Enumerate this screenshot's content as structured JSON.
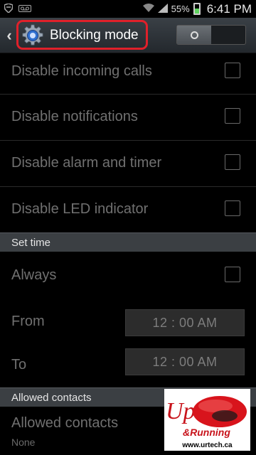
{
  "status_bar": {
    "battery_percent": "55%",
    "time": "6:41 PM",
    "icons": [
      "shield-icon",
      "voicemail-icon",
      "wifi-icon",
      "signal-icon",
      "battery-icon"
    ]
  },
  "action_bar": {
    "title": "Blocking mode",
    "toggle_on": false,
    "highlight_color": "#e0202a"
  },
  "items": {
    "incoming_calls": "Disable incoming calls",
    "notifications": "Disable notifications",
    "alarm_timer": "Disable alarm and timer",
    "led_indicator": "Disable LED indicator"
  },
  "set_time": {
    "header": "Set time",
    "always": "Always",
    "from_label": "From",
    "from_value": "12 : 00 AM",
    "to_label": "To",
    "to_value": "12 : 00 AM"
  },
  "allowed_contacts": {
    "header": "Allowed contacts",
    "label": "Allowed contacts",
    "value": "None"
  },
  "watermark": {
    "logo_text": "Up & Running Technologies Incorporated",
    "url": "www.urtech.ca"
  }
}
